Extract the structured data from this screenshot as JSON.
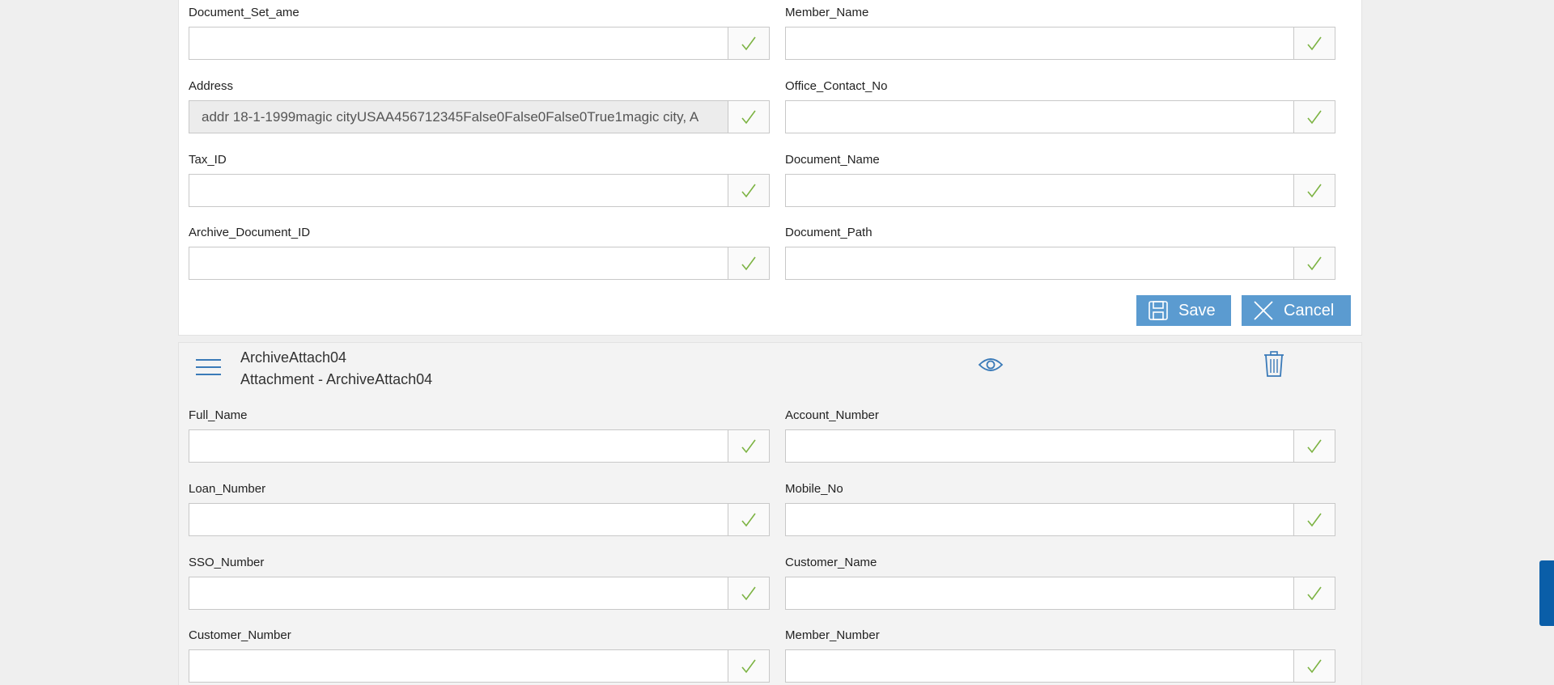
{
  "top_form": {
    "fields": [
      {
        "label": "Document_Set_ame",
        "value": ""
      },
      {
        "label": "Member_Name",
        "value": ""
      },
      {
        "label": "Address",
        "value": "addr 18-1-1999magic cityUSAA456712345False0False0False0True1magic city, A"
      },
      {
        "label": "Office_Contact_No",
        "value": ""
      },
      {
        "label": "Tax_ID",
        "value": ""
      },
      {
        "label": "Document_Name",
        "value": ""
      },
      {
        "label": "Archive_Document_ID",
        "value": ""
      },
      {
        "label": "Document_Path",
        "value": ""
      }
    ],
    "save_label": "Save",
    "cancel_label": "Cancel"
  },
  "attachment": {
    "title": "ArchiveAttach04",
    "subtitle": "Attachment - ArchiveAttach04",
    "icons": {
      "menu": "hamburger-icon",
      "view": "eye-icon",
      "delete": "trash-icon",
      "field_status": "check-icon"
    },
    "fields": [
      {
        "label": "Full_Name",
        "value": ""
      },
      {
        "label": "Account_Number",
        "value": ""
      },
      {
        "label": "Loan_Number",
        "value": ""
      },
      {
        "label": "Mobile_No",
        "value": ""
      },
      {
        "label": "SSO_Number",
        "value": ""
      },
      {
        "label": "Customer_Name",
        "value": ""
      },
      {
        "label": "Customer_Number",
        "value": ""
      },
      {
        "label": "Member_Number",
        "value": ""
      }
    ]
  },
  "colors": {
    "accent": "#5b9bd0",
    "check": "#7cb342",
    "side_tab": "#0a5ea8",
    "icon_blue": "#3a7ab8"
  }
}
